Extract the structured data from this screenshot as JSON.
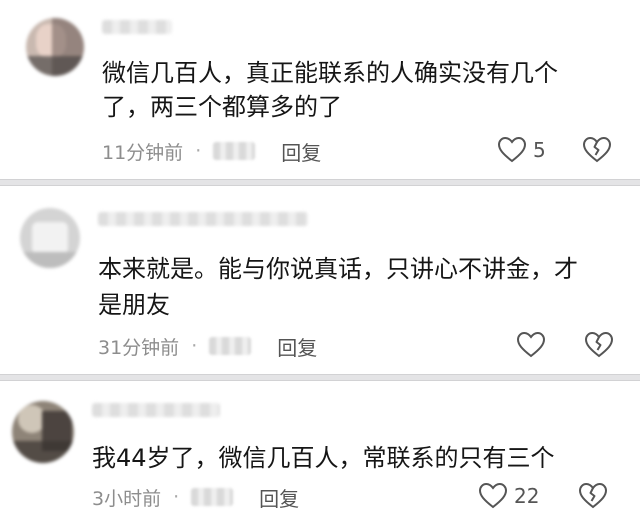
{
  "comments": [
    {
      "lines": [
        "微信几百人，真正能联系的人确实没有几个",
        "了，两三个都算多的了"
      ],
      "time": "11分钟前",
      "reply": "回复",
      "likes": "5"
    },
    {
      "lines": [
        "本来就是。能与你说真话，只讲心不讲金，才",
        "是朋友"
      ],
      "time": "31分钟前",
      "reply": "回复",
      "likes": ""
    },
    {
      "lines": [
        "我44岁了，微信几百人，常联系的只有三个"
      ],
      "time": "3小时前",
      "reply": "回复",
      "likes": "22"
    }
  ],
  "separator_dot": "·",
  "icons": {
    "like": "heart-outline-icon",
    "dislike": "broken-heart-icon"
  },
  "colors": {
    "text": "#161616",
    "meta": "#8d8d8d",
    "separator": "#e4e4e6"
  }
}
